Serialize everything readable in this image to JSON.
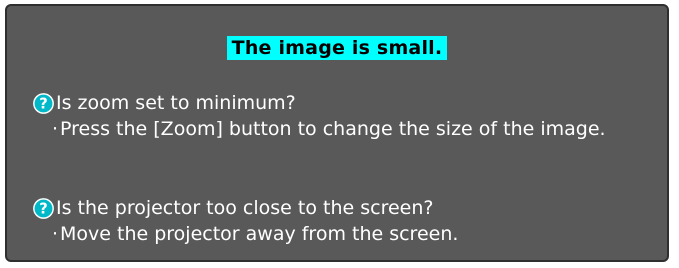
{
  "dialog": {
    "title": "The image is small.",
    "title_bg_color": "#00ffff",
    "panel_color": "#595959",
    "items": [
      {
        "icon": "question-icon",
        "question": "Is zoom set to minimum?",
        "bullet": "·",
        "answer": "Press the [Zoom] button to change the size of the image."
      },
      {
        "icon": "question-icon",
        "question": "Is the projector too close to the screen?",
        "bullet": "·",
        "answer": "Move the projector away from the screen."
      }
    ]
  }
}
